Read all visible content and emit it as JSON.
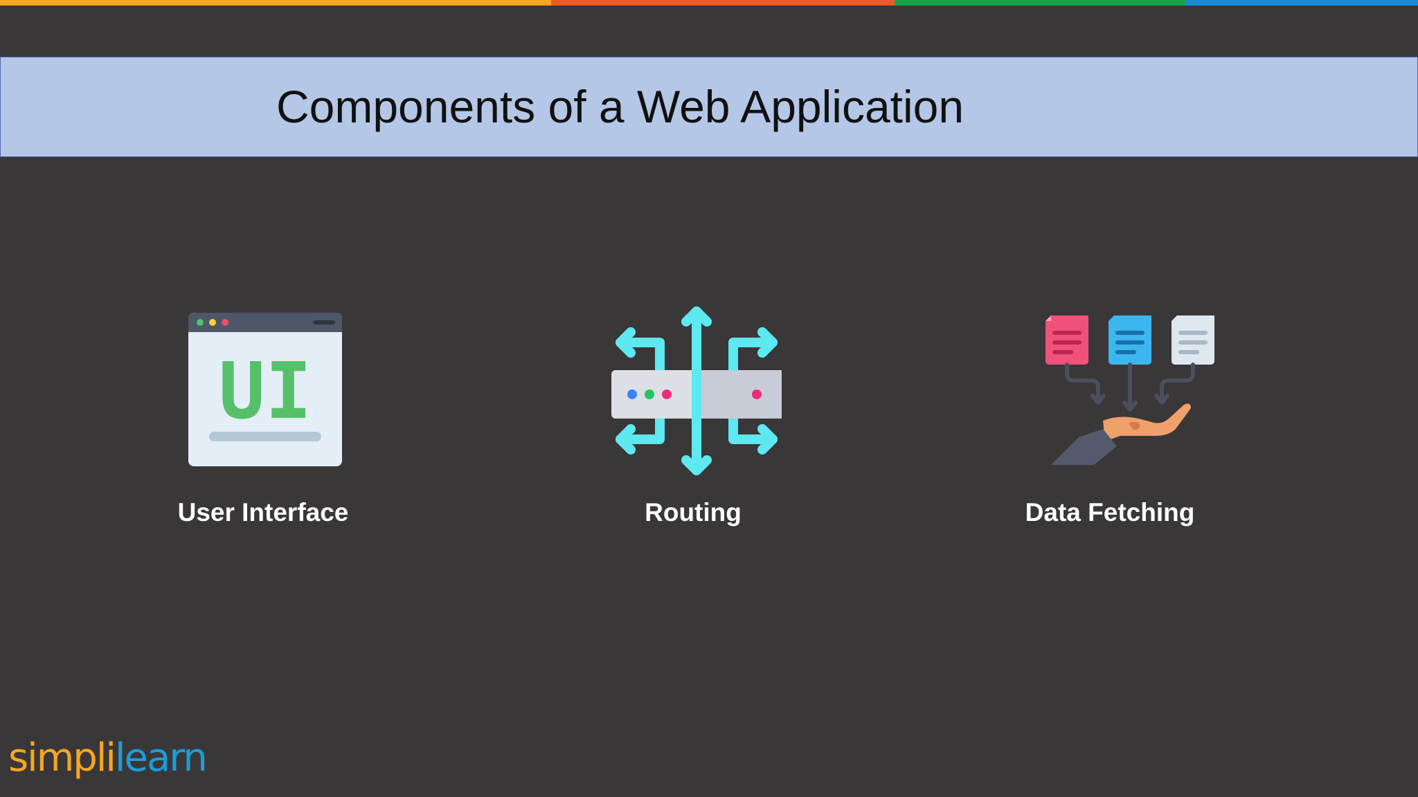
{
  "slide": {
    "title": "Components of a Web Application"
  },
  "top_bar": {
    "colors": [
      "#f5a623",
      "#ee5a24",
      "#16a34a",
      "#1a8ad8"
    ]
  },
  "components": [
    {
      "label": "User Interface",
      "icon": "ui-window-icon",
      "icon_text": "UI"
    },
    {
      "label": "Routing",
      "icon": "routing-arrows-icon"
    },
    {
      "label": "Data Fetching",
      "icon": "data-fetching-documents-icon"
    }
  ],
  "logo": {
    "part1": "simpl",
    "pipe": "i",
    "part2": "learn",
    "colors": {
      "simpl": "#f5a623",
      "learn": "#1b9dd8"
    }
  }
}
